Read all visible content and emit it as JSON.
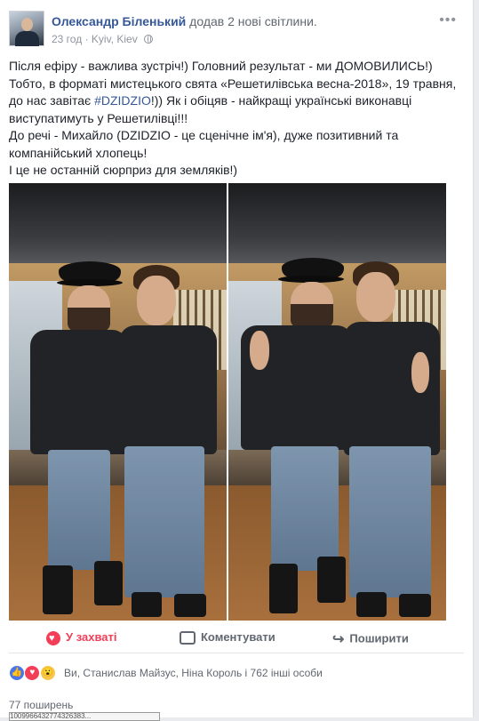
{
  "post": {
    "author": "Олександр Біленький",
    "action": "додав 2 нові світлини.",
    "time": "23 год",
    "location": "Kyiv, Kiev",
    "more": "•••",
    "text": {
      "line1": "Після ефіру - важлива зустріч!) Головний результат - ми ДОМОВИЛИСЬ!)",
      "line2_pre": "Тобто, в форматі мистецького свята «Решетилівська весна-2018», 19 травня, до нас завітає ",
      "hashtag": "#DZIDZIO",
      "line2_post": "!)) Як і обіцяв - найкращі українські виконавці виступатимуть у Решетилівці!!!",
      "line3": "До речі - Михайло (DZIDZIO - це сценічне ім'я), дуже позитивний та компанійський хлопець!",
      "line4": "І це не останній сюрприз для земляків!)"
    }
  },
  "actions": {
    "like": "У захваті",
    "comment": "Коментувати",
    "share": "Поширити"
  },
  "reactions": {
    "summary": "Ви, Станислав Майзус, Ніна Король і 762 інші особи",
    "icons": [
      "like-icon",
      "love-icon",
      "wow-icon"
    ]
  },
  "shares": "77 поширень",
  "url_fragment": "1009966432774326383...",
  "colors": {
    "link": "#365899",
    "love": "#f33e58",
    "like": "#4a76e8",
    "wow": "#f7c74b"
  }
}
